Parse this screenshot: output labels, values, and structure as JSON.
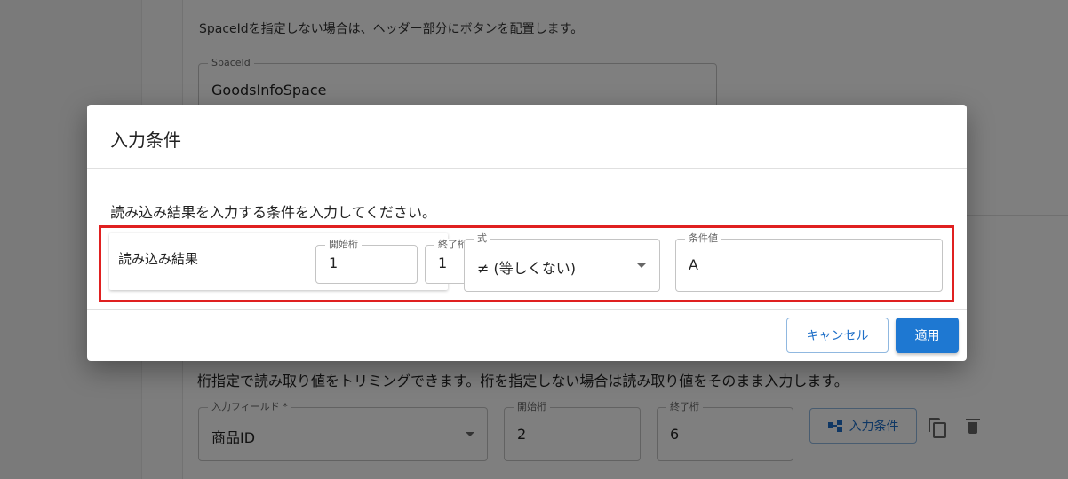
{
  "background": {
    "description": "SpaceIdを指定しない場合は、ヘッダー部分にボタンを配置します。",
    "space_id_field": {
      "label": "SpaceId",
      "value": "GoodsInfoSpace"
    },
    "trim_description": "桁指定で読み取り値をトリミングできます。桁を指定しない場合は読み取り値をそのまま入力します。",
    "row": {
      "input_field": {
        "label": "入力フィールド *",
        "value": "商品ID"
      },
      "start_digit": {
        "label": "開始桁",
        "value": "2"
      },
      "end_digit": {
        "label": "終了桁",
        "value": "6"
      },
      "condition_button_label": "入力条件"
    }
  },
  "dialog": {
    "title": "入力条件",
    "instruction": "読み込み結果を入力する条件を入力してください。",
    "group_label": "読み込み結果",
    "start_digit": {
      "label": "開始桁",
      "value": "1"
    },
    "end_digit": {
      "label": "終了桁",
      "value": "1"
    },
    "expression": {
      "label": "式",
      "value": "≠ (等しくない)"
    },
    "condition_value": {
      "label": "条件値",
      "value": "A"
    },
    "cancel_label": "キャンセル",
    "apply_label": "適用"
  },
  "colors": {
    "primary": "#1e78d2",
    "highlight": "#e02020"
  },
  "icons": [
    "chevron-down-icon",
    "tree-structure-icon",
    "copy-icon",
    "trash-icon"
  ]
}
